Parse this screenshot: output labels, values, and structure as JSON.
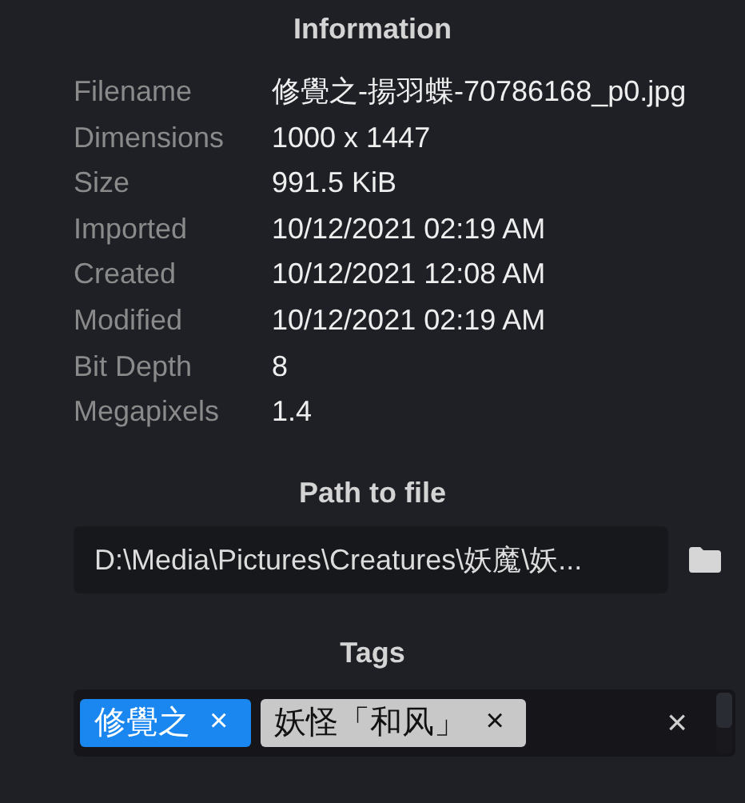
{
  "title": "Information",
  "properties": [
    {
      "label": "Filename",
      "value": "修覺之-揚羽蝶-70786168_p0.jpg"
    },
    {
      "label": "Dimensions",
      "value": "1000 x 1447"
    },
    {
      "label": "Size",
      "value": "991.5 KiB"
    },
    {
      "label": "Imported",
      "value": "10/12/2021 02:19 AM"
    },
    {
      "label": "Created",
      "value": "10/12/2021 12:08 AM"
    },
    {
      "label": "Modified",
      "value": "10/12/2021 02:19 AM"
    },
    {
      "label": "Bit Depth",
      "value": "8"
    },
    {
      "label": "Megapixels",
      "value": "1.4"
    }
  ],
  "path_section": {
    "title": "Path to file",
    "value": "D:\\Media\\Pictures\\Creatures\\妖魔\\妖..."
  },
  "tags_section": {
    "title": "Tags",
    "tags": [
      {
        "label": "修覺之",
        "remove": "×",
        "color": "#1a86f0"
      },
      {
        "label": "妖怪「和风」",
        "remove": "×",
        "color": "#c8c8c8"
      }
    ],
    "clear": "×"
  }
}
